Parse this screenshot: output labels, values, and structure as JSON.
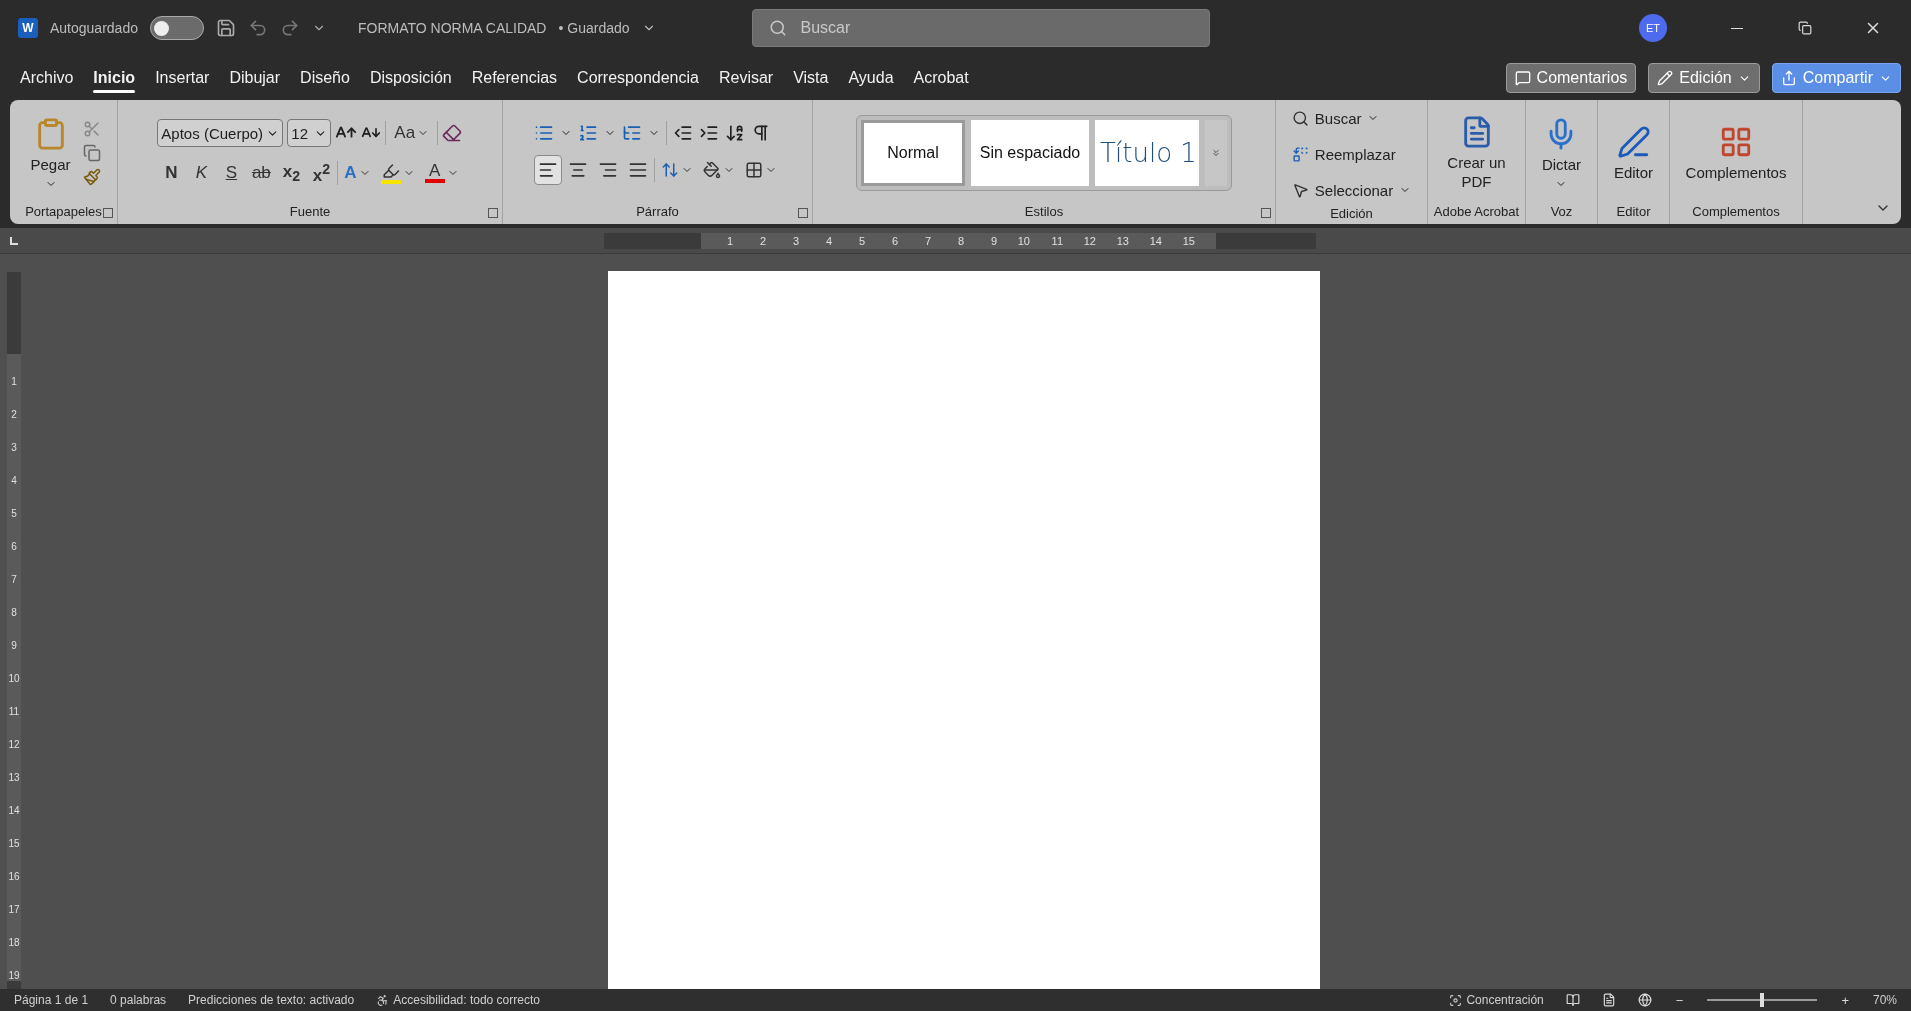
{
  "app": {
    "logo": "W",
    "autosave": {
      "label": "Autoguardado",
      "on": false
    },
    "title": "FORMATO NORMA CALIDAD",
    "save_state": "• Guardado",
    "search": {
      "placeholder": "Buscar"
    },
    "avatar": "ET"
  },
  "menu_tabs": [
    {
      "label": "Archivo",
      "selected": false
    },
    {
      "label": "Inicio",
      "selected": true
    },
    {
      "label": "Insertar",
      "selected": false
    },
    {
      "label": "Dibujar",
      "selected": false
    },
    {
      "label": "Diseño",
      "selected": false
    },
    {
      "label": "Disposición",
      "selected": false
    },
    {
      "label": "Referencias",
      "selected": false
    },
    {
      "label": "Correspondencia",
      "selected": false
    },
    {
      "label": "Revisar",
      "selected": false
    },
    {
      "label": "Vista",
      "selected": false
    },
    {
      "label": "Ayuda",
      "selected": false
    },
    {
      "label": "Acrobat",
      "selected": false
    }
  ],
  "header_buttons": [
    {
      "kind": "comment",
      "label": "Comentarios"
    },
    {
      "kind": "edit",
      "label": "Edición"
    },
    {
      "kind": "share",
      "label": "Compartir"
    }
  ],
  "ribbon": {
    "clipboard": {
      "paste": "Pegar",
      "label": "Portapapeles"
    },
    "font": {
      "name": "Aptos (Cuerpo)",
      "size": "12",
      "case": "Aa",
      "format": [
        {
          "kind": "bold",
          "text": "N"
        },
        {
          "kind": "italic",
          "text": "K"
        },
        {
          "kind": "underline",
          "text": "S"
        },
        {
          "kind": "strike",
          "text": "ab"
        },
        {
          "kind": "sub",
          "text": "x$_{2}$"
        },
        {
          "kind": "sup",
          "text": "x$^{2}$"
        }
      ],
      "effects": "A",
      "font_color": "A",
      "label": "Fuente"
    },
    "paragraph": {
      "alignment": [
        {
          "kind": "left",
          "selected": true
        },
        {
          "kind": "center",
          "selected": false
        },
        {
          "kind": "right",
          "selected": false
        },
        {
          "kind": "justify",
          "selected": false
        }
      ],
      "label": "Párrafo"
    },
    "styles": {
      "items": [
        {
          "label": "Normal",
          "kind": "normal",
          "selected": true
        },
        {
          "label": "Sin espaciado",
          "kind": "normal",
          "selected": false
        },
        {
          "label": "Título 1",
          "kind": "heading",
          "selected": false
        }
      ],
      "label": "Estilos"
    },
    "editing": {
      "items": [
        {
          "kind": "find",
          "label": "Buscar"
        },
        {
          "kind": "replace",
          "label": "Reemplazar"
        },
        {
          "kind": "select",
          "label": "Seleccionar"
        }
      ],
      "label": "Edición"
    },
    "big_groups": [
      {
        "kind": "pdf",
        "button": "Crear un PDF",
        "label": "Adobe Acrobat"
      },
      {
        "kind": "dictate",
        "button": "Dictar",
        "label": "Voz"
      },
      {
        "kind": "editor",
        "button": "Editor",
        "label": "Editor"
      },
      {
        "kind": "addins",
        "button": "Complementos",
        "label": "Complementos"
      }
    ]
  },
  "ruler": {
    "horizontal": [
      "1",
      "2",
      "3",
      "4",
      "5",
      "6",
      "7",
      "8",
      "9",
      "10",
      "11",
      "12",
      "13",
      "14",
      "15"
    ],
    "vertical": [
      "1",
      "2",
      "3",
      "4",
      "5",
      "6",
      "7",
      "8",
      "9",
      "10",
      "11",
      "12",
      "13",
      "14",
      "15",
      "16",
      "17",
      "18",
      "19"
    ]
  },
  "status_bar": {
    "page": "Página 1 de 1",
    "words": "0 palabras",
    "predictions": "Predicciones de texto: activado",
    "accessibility": "Accesibilidad: todo correcto",
    "focus": "Concentración",
    "zoom_out": "−",
    "zoom_in": "+",
    "zoom": "70%",
    "zoom_slider": {
      "level": 0.5
    }
  }
}
